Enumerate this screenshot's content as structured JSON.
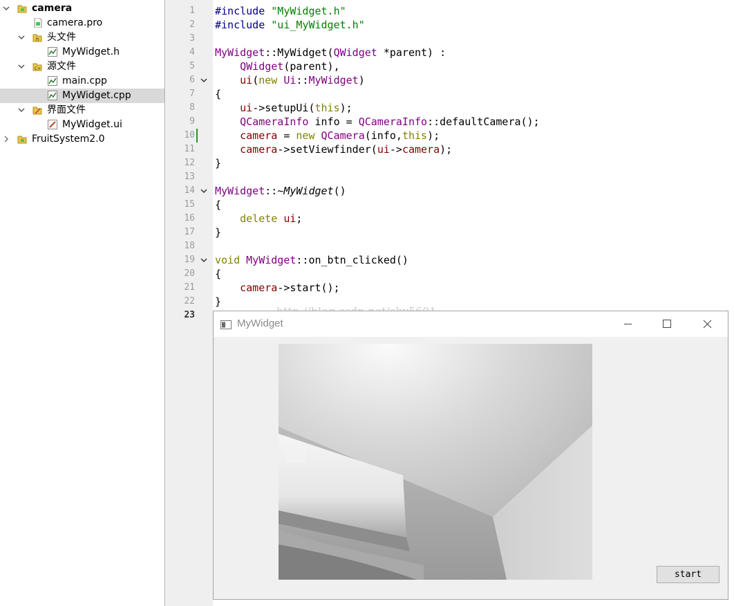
{
  "project_tree": {
    "items": [
      {
        "label": "camera",
        "icon": "qt-project-icon",
        "expanded": true,
        "bold": true
      },
      {
        "label": "camera.pro",
        "icon": "pro-file-icon"
      },
      {
        "label": "头文件",
        "icon": "header-folder-icon",
        "expanded": true
      },
      {
        "label": "MyWidget.h",
        "icon": "header-file-icon"
      },
      {
        "label": "源文件",
        "icon": "source-folder-icon",
        "expanded": true
      },
      {
        "label": "main.cpp",
        "icon": "cpp-file-icon"
      },
      {
        "label": "MyWidget.cpp",
        "icon": "cpp-file-icon",
        "selected": true
      },
      {
        "label": "界面文件",
        "icon": "form-folder-icon",
        "expanded": true
      },
      {
        "label": "MyWidget.ui",
        "icon": "ui-file-icon"
      },
      {
        "label": "FruitSystem2.0",
        "icon": "qt-project-icon",
        "expanded": false
      }
    ]
  },
  "editor": {
    "line_numbers": [
      "1",
      "2",
      "3",
      "4",
      "5",
      "6",
      "7",
      "8",
      "9",
      "10",
      "11",
      "12",
      "13",
      "14",
      "15",
      "16",
      "17",
      "18",
      "19",
      "20",
      "21",
      "22",
      "23"
    ],
    "current_line": "23",
    "fold_markers": [
      "6",
      "14",
      "19"
    ],
    "code": {
      "l1_pp": "#include ",
      "l1_str": "\"MyWidget.h\"",
      "l2_pp": "#include ",
      "l2_str": "\"ui_MyWidget.h\"",
      "l4_class": "MyWidget",
      "l4_mid": "::MyWidget(",
      "l4_type": "QWidget",
      "l4_end": " *parent) :",
      "l5_indent": "    ",
      "l5_type": "QWidget",
      "l5_end": "(parent),",
      "l6_indent": "    ",
      "l6_fld": "ui",
      "l6_open": "(",
      "l6_kw": "new",
      "l6_sp": " ",
      "l6_ns": "Ui",
      "l6_sep": "::",
      "l6_cls": "MyWidget",
      "l6_close": ")",
      "l7": "{",
      "l8_indent": "    ",
      "l8_fld": "ui",
      "l8_mid": "->setupUi(",
      "l8_kw": "this",
      "l8_end": ");",
      "l9_indent": "    ",
      "l9_type": "QCameraInfo",
      "l9_mid": " info = ",
      "l9_type2": "QCameraInfo",
      "l9_end": "::defaultCamera();",
      "l10_indent": "    ",
      "l10_fld": "camera",
      "l10_mid": " = ",
      "l10_kw": "new",
      "l10_sp": " ",
      "l10_type": "QCamera",
      "l10_mid2": "(info,",
      "l10_kw2": "this",
      "l10_end": ");",
      "l11_indent": "    ",
      "l11_fld": "camera",
      "l11_mid": "->setViewfinder(",
      "l11_fld2": "ui",
      "l11_arrow": "->",
      "l11_fld3": "camera",
      "l11_end": ");",
      "l12": "}",
      "l14_class": "MyWidget",
      "l14_mid": "::~",
      "l14_it": "MyWidget",
      "l14_end": "()",
      "l15": "{",
      "l16_indent": "    ",
      "l16_kw": "delete",
      "l16_sp": " ",
      "l16_fld": "ui",
      "l16_end": ";",
      "l17": "}",
      "l19_kw": "void",
      "l19_sp": " ",
      "l19_class": "MyWidget",
      "l19_end": "::on_btn_clicked()",
      "l20": "{",
      "l21_indent": "    ",
      "l21_fld": "camera",
      "l21_end": "->start();",
      "l22": "}"
    },
    "watermark": "http://blog.csdn.net/sky5601"
  },
  "window": {
    "title": "MyWidget",
    "start_button": "start"
  },
  "colors": {
    "preprocessor": "#000080",
    "string": "#008000",
    "type": "#800080",
    "keyword": "#808000",
    "member": "#800000",
    "selection": "#d9d9d9",
    "change_bar": "#1f9c1f"
  }
}
